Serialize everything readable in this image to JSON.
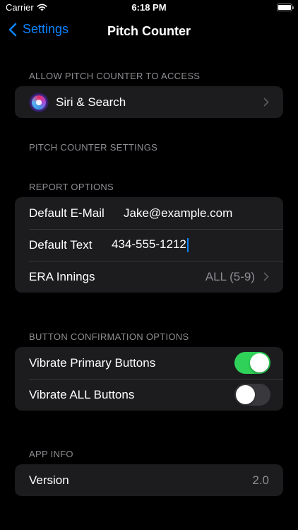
{
  "status_bar": {
    "carrier": "Carrier",
    "time": "6:18 PM"
  },
  "nav": {
    "back_label": "Settings",
    "title": "Pitch Counter"
  },
  "sections": {
    "access_header": "ALLOW PITCH COUNTER TO ACCESS",
    "pitch_settings_header": "PITCH COUNTER SETTINGS",
    "report_header": "REPORT OPTIONS",
    "button_confirm_header": "BUTTON CONFIRMATION OPTIONS",
    "app_info_header": "APP INFO"
  },
  "access": {
    "siri_label": "Siri & Search",
    "icon": "siri-icon"
  },
  "report": {
    "email_label": "Default E-Mail",
    "email_value": "Jake@example.com",
    "text_label": "Default Text",
    "text_value": "434-555-1212",
    "era_label": "ERA Innings",
    "era_value": "ALL (5-9)"
  },
  "buttons": {
    "vibrate_primary_label": "Vibrate Primary Buttons",
    "vibrate_primary_on": true,
    "vibrate_all_label": "Vibrate ALL Buttons",
    "vibrate_all_on": false
  },
  "app_info": {
    "version_label": "Version",
    "version_value": "2.0"
  },
  "colors": {
    "accent": "#0a84ff",
    "toggle_on": "#30d158",
    "cell_bg": "#1c1c1e",
    "secondary_text": "#8e8e93"
  }
}
